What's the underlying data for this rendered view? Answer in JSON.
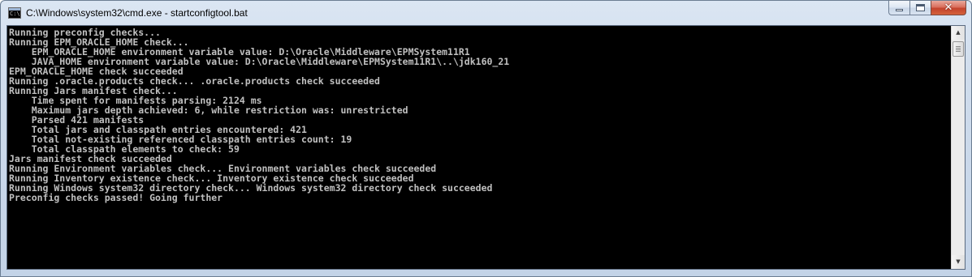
{
  "window": {
    "title": "C:\\Windows\\system32\\cmd.exe - startconfigtool.bat",
    "icon": "cmd-icon",
    "icon_text": "C:\\",
    "buttons": {
      "minimize_icon": "minimize-icon",
      "maximize_icon": "maximize-icon",
      "close_icon": "close-icon",
      "close_glyph": "✕"
    }
  },
  "console": {
    "lines": [
      "Running preconfig checks...",
      "Running EPM_ORACLE_HOME check...",
      "    EPM_ORACLE_HOME environment variable value: D:\\Oracle\\Middleware\\EPMSystem11R1",
      "    JAVA_HOME environment variable value: D:\\Oracle\\Middleware\\EPMSystem11R1\\..\\jdk160_21",
      "EPM_ORACLE_HOME check succeeded",
      "Running .oracle.products check... .oracle.products check succeeded",
      "Running Jars manifest check...",
      "    Time spent for manifests parsing: 2124 ms",
      "    Maximum jars depth achieved: 6, while restriction was: unrestricted",
      "    Parsed 421 manifests",
      "    Total jars and classpath entries encountered: 421",
      "    Total not-existing referenced classpath entries count: 19",
      "    Total classpath elements to check: 59",
      "Jars manifest check succeeded",
      "Running Environment variables check... Environment variables check succeeded",
      "Running Inventory existence check... Inventory existence check succeeded",
      "Running Windows system32 directory check... Windows system32 directory check succeeded",
      "Preconfig checks passed! Going further"
    ],
    "colors": {
      "background": "#000000",
      "text": "#c0c0c0"
    }
  },
  "scrollbar": {
    "up_arrow": "▲",
    "down_arrow": "▼",
    "position": 0
  }
}
